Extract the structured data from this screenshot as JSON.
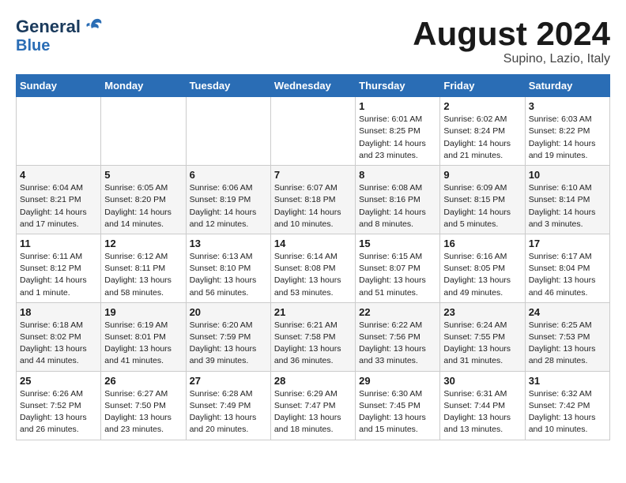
{
  "header": {
    "logo_line1": "General",
    "logo_line2": "Blue",
    "month_title": "August 2024",
    "location": "Supino, Lazio, Italy"
  },
  "weekdays": [
    "Sunday",
    "Monday",
    "Tuesday",
    "Wednesday",
    "Thursday",
    "Friday",
    "Saturday"
  ],
  "weeks": [
    [
      {
        "day": "",
        "info": ""
      },
      {
        "day": "",
        "info": ""
      },
      {
        "day": "",
        "info": ""
      },
      {
        "day": "",
        "info": ""
      },
      {
        "day": "1",
        "info": "Sunrise: 6:01 AM\nSunset: 8:25 PM\nDaylight: 14 hours\nand 23 minutes."
      },
      {
        "day": "2",
        "info": "Sunrise: 6:02 AM\nSunset: 8:24 PM\nDaylight: 14 hours\nand 21 minutes."
      },
      {
        "day": "3",
        "info": "Sunrise: 6:03 AM\nSunset: 8:22 PM\nDaylight: 14 hours\nand 19 minutes."
      }
    ],
    [
      {
        "day": "4",
        "info": "Sunrise: 6:04 AM\nSunset: 8:21 PM\nDaylight: 14 hours\nand 17 minutes."
      },
      {
        "day": "5",
        "info": "Sunrise: 6:05 AM\nSunset: 8:20 PM\nDaylight: 14 hours\nand 14 minutes."
      },
      {
        "day": "6",
        "info": "Sunrise: 6:06 AM\nSunset: 8:19 PM\nDaylight: 14 hours\nand 12 minutes."
      },
      {
        "day": "7",
        "info": "Sunrise: 6:07 AM\nSunset: 8:18 PM\nDaylight: 14 hours\nand 10 minutes."
      },
      {
        "day": "8",
        "info": "Sunrise: 6:08 AM\nSunset: 8:16 PM\nDaylight: 14 hours\nand 8 minutes."
      },
      {
        "day": "9",
        "info": "Sunrise: 6:09 AM\nSunset: 8:15 PM\nDaylight: 14 hours\nand 5 minutes."
      },
      {
        "day": "10",
        "info": "Sunrise: 6:10 AM\nSunset: 8:14 PM\nDaylight: 14 hours\nand 3 minutes."
      }
    ],
    [
      {
        "day": "11",
        "info": "Sunrise: 6:11 AM\nSunset: 8:12 PM\nDaylight: 14 hours\nand 1 minute."
      },
      {
        "day": "12",
        "info": "Sunrise: 6:12 AM\nSunset: 8:11 PM\nDaylight: 13 hours\nand 58 minutes."
      },
      {
        "day": "13",
        "info": "Sunrise: 6:13 AM\nSunset: 8:10 PM\nDaylight: 13 hours\nand 56 minutes."
      },
      {
        "day": "14",
        "info": "Sunrise: 6:14 AM\nSunset: 8:08 PM\nDaylight: 13 hours\nand 53 minutes."
      },
      {
        "day": "15",
        "info": "Sunrise: 6:15 AM\nSunset: 8:07 PM\nDaylight: 13 hours\nand 51 minutes."
      },
      {
        "day": "16",
        "info": "Sunrise: 6:16 AM\nSunset: 8:05 PM\nDaylight: 13 hours\nand 49 minutes."
      },
      {
        "day": "17",
        "info": "Sunrise: 6:17 AM\nSunset: 8:04 PM\nDaylight: 13 hours\nand 46 minutes."
      }
    ],
    [
      {
        "day": "18",
        "info": "Sunrise: 6:18 AM\nSunset: 8:02 PM\nDaylight: 13 hours\nand 44 minutes."
      },
      {
        "day": "19",
        "info": "Sunrise: 6:19 AM\nSunset: 8:01 PM\nDaylight: 13 hours\nand 41 minutes."
      },
      {
        "day": "20",
        "info": "Sunrise: 6:20 AM\nSunset: 7:59 PM\nDaylight: 13 hours\nand 39 minutes."
      },
      {
        "day": "21",
        "info": "Sunrise: 6:21 AM\nSunset: 7:58 PM\nDaylight: 13 hours\nand 36 minutes."
      },
      {
        "day": "22",
        "info": "Sunrise: 6:22 AM\nSunset: 7:56 PM\nDaylight: 13 hours\nand 33 minutes."
      },
      {
        "day": "23",
        "info": "Sunrise: 6:24 AM\nSunset: 7:55 PM\nDaylight: 13 hours\nand 31 minutes."
      },
      {
        "day": "24",
        "info": "Sunrise: 6:25 AM\nSunset: 7:53 PM\nDaylight: 13 hours\nand 28 minutes."
      }
    ],
    [
      {
        "day": "25",
        "info": "Sunrise: 6:26 AM\nSunset: 7:52 PM\nDaylight: 13 hours\nand 26 minutes."
      },
      {
        "day": "26",
        "info": "Sunrise: 6:27 AM\nSunset: 7:50 PM\nDaylight: 13 hours\nand 23 minutes."
      },
      {
        "day": "27",
        "info": "Sunrise: 6:28 AM\nSunset: 7:49 PM\nDaylight: 13 hours\nand 20 minutes."
      },
      {
        "day": "28",
        "info": "Sunrise: 6:29 AM\nSunset: 7:47 PM\nDaylight: 13 hours\nand 18 minutes."
      },
      {
        "day": "29",
        "info": "Sunrise: 6:30 AM\nSunset: 7:45 PM\nDaylight: 13 hours\nand 15 minutes."
      },
      {
        "day": "30",
        "info": "Sunrise: 6:31 AM\nSunset: 7:44 PM\nDaylight: 13 hours\nand 13 minutes."
      },
      {
        "day": "31",
        "info": "Sunrise: 6:32 AM\nSunset: 7:42 PM\nDaylight: 13 hours\nand 10 minutes."
      }
    ]
  ]
}
